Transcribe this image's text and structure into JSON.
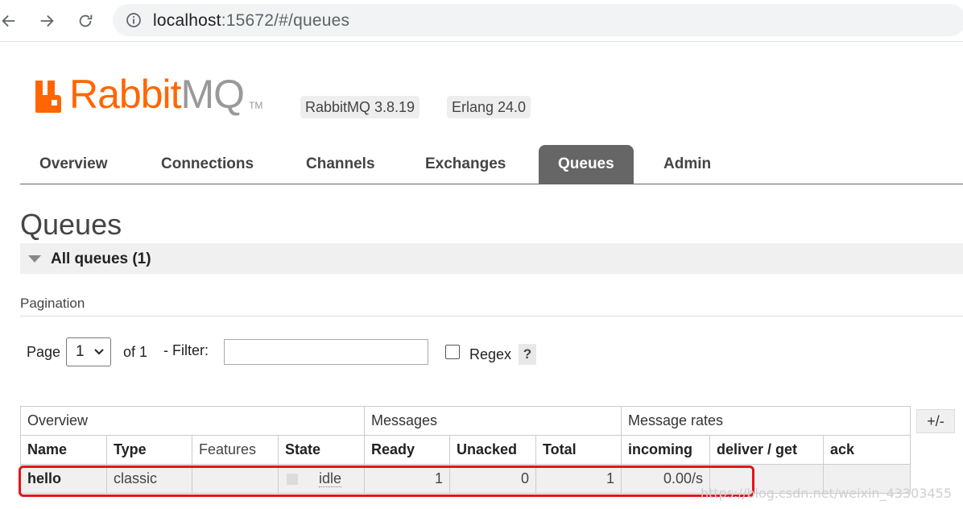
{
  "browser": {
    "url_host": "localhost",
    "url_rest": ":15672/#/queues"
  },
  "header": {
    "logo_rabbit": "Rabbit",
    "logo_mq": "MQ",
    "logo_tm": "TM",
    "version": "RabbitMQ 3.8.19",
    "erlang": "Erlang 24.0"
  },
  "tabs": [
    {
      "label": "Overview"
    },
    {
      "label": "Connections"
    },
    {
      "label": "Channels"
    },
    {
      "label": "Exchanges"
    },
    {
      "label": "Queues",
      "active": true
    },
    {
      "label": "Admin"
    }
  ],
  "page": {
    "title": "Queues",
    "section": "All queues (1)",
    "pagination_label": "Pagination"
  },
  "pager": {
    "page_label": "Page",
    "page_value": "1",
    "of_label": "of 1",
    "filter_label": "- Filter:",
    "filter_value": "",
    "regex_label": "Regex",
    "help": "?"
  },
  "table": {
    "groups": [
      "Overview",
      "Messages",
      "Message rates"
    ],
    "columns": [
      "Name",
      "Type",
      "Features",
      "State",
      "Ready",
      "Unacked",
      "Total",
      "incoming",
      "deliver / get",
      "ack"
    ],
    "rows": [
      {
        "name": "hello",
        "type": "classic",
        "features": "",
        "state": "idle",
        "ready": "1",
        "unacked": "0",
        "total": "1",
        "incoming": "0.00/s",
        "deliver_get": "",
        "ack": ""
      }
    ],
    "toggle": "+/-"
  },
  "watermark": "https://blog.csdn.net/weixin_43303455",
  "colors": {
    "brand_orange": "#ff6600",
    "active_tab": "#666666",
    "highlight": "#e5141b"
  }
}
